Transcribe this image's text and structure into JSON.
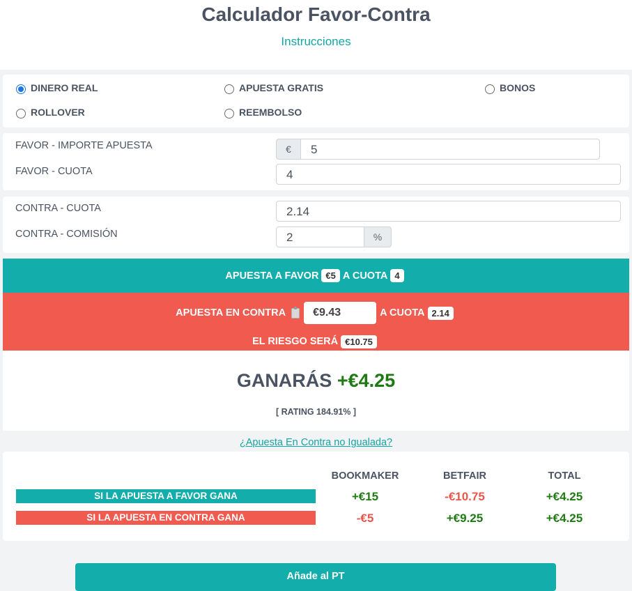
{
  "header": {
    "title": "Calculador Favor-Contra",
    "instructions_link": "Instrucciones"
  },
  "bet_types": [
    {
      "label": "DINERO REAL",
      "checked": true
    },
    {
      "label": "APUESTA GRATIS",
      "checked": false
    },
    {
      "label": "BONOS",
      "checked": false
    },
    {
      "label": "ROLLOVER",
      "checked": false
    },
    {
      "label": "REEMBOLSO",
      "checked": false
    }
  ],
  "favor": {
    "stake_label": "FAVOR - IMPORTE APUESTA",
    "stake_prefix": "€",
    "stake_value": "5",
    "odds_label": "FAVOR - CUOTA",
    "odds_value": "4"
  },
  "contra": {
    "odds_label": "CONTRA - CUOTA",
    "odds_value": "2.14",
    "commission_label": "CONTRA - COMISIÓN",
    "commission_value": "2",
    "commission_suffix": "%"
  },
  "summary": {
    "favor_text": "APUESTA A FAVOR",
    "favor_stake": "€5",
    "favor_odds_text": "A CUOTA",
    "favor_odds": "4",
    "contra_text": "APUESTA EN CONTRA",
    "contra_stake": "€9.43",
    "contra_odds_text": "A CUOTA",
    "contra_odds": "2.14",
    "risk_text": "EL RIESGO SERÁ",
    "risk_value": "€10.75",
    "win_text": "GANARÁS",
    "win_value": "+€4.25",
    "rating": "[ RATING 184.91% ]"
  },
  "unmatched_link": "¿Apuesta En Contra no Igualada?",
  "outcomes": {
    "headers": [
      "BOOKMAKER",
      "BETFAIR",
      "TOTAL"
    ],
    "rows": [
      {
        "label": "SI LA APUESTA A FAVOR GANA",
        "bookmaker": "+€15",
        "betfair": "-€10.75",
        "total": "+€4.25",
        "color": "#13aeab"
      },
      {
        "label": "SI LA APUESTA EN CONTRA GANA",
        "bookmaker": "-€5",
        "betfair": "+€9.25",
        "total": "+€4.25",
        "color": "#f05a4f"
      }
    ]
  },
  "add_button": "Añade al PT",
  "colors": {
    "teal": "#13aeab",
    "red": "#f05a4f",
    "positive": "#1e7b12",
    "negative": "#e8564c",
    "radio_checked": "#1a73e8"
  }
}
